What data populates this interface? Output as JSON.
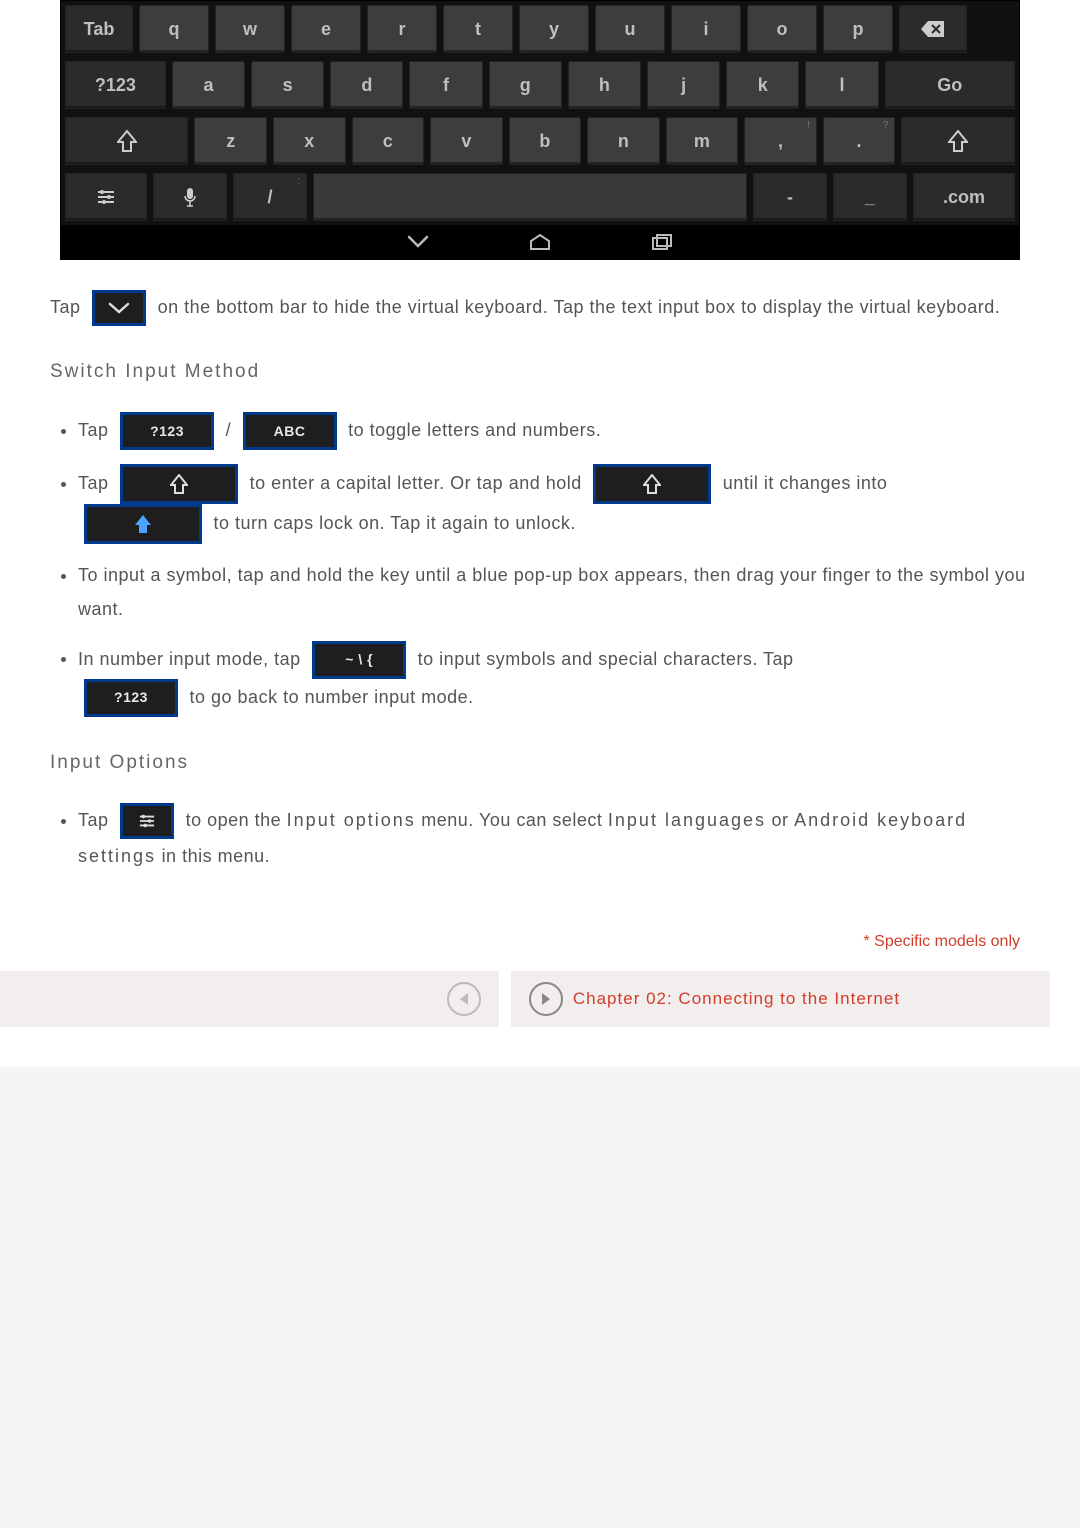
{
  "keyboard": {
    "row1": {
      "tab": "Tab",
      "keys": [
        "q",
        "w",
        "e",
        "r",
        "t",
        "y",
        "u",
        "i",
        "o",
        "p"
      ],
      "backspace_icon": "⌫"
    },
    "row2": {
      "mode": "?123",
      "keys": [
        "a",
        "s",
        "d",
        "f",
        "g",
        "h",
        "j",
        "k",
        "l"
      ],
      "go": "Go"
    },
    "row3": {
      "shift_icon": "⇧",
      "keys": [
        "z",
        "x",
        "c",
        "v",
        "b",
        "n",
        "m"
      ],
      "comma": ",",
      "period": ".",
      "comma_hint": "!",
      "period_hint": "?",
      "shiftR_icon": "⇧"
    },
    "row4": {
      "options_icon": "⎈",
      "mic_icon": "🎤",
      "slash": "/",
      "slash_hint": ":",
      "dash": "-",
      "underscore": "_",
      "com": ".com"
    },
    "navbar": {
      "hide": "⌄",
      "home": "⌂",
      "recent": "❐"
    }
  },
  "body": {
    "hide_keyboard": {
      "pre": "Tap",
      "post": "on the bottom bar to hide the virtual keyboard. Tap the text input box to display the virtual keyboard."
    },
    "switch_heading": "Switch Input Method",
    "bullets": {
      "b1": {
        "pre": "Tap",
        "chip1": "?123",
        "sep": "/",
        "chip2": "ABC",
        "post": "to toggle letters and numbers."
      },
      "b2": {
        "pre": "Tap",
        "chip1": "⇧",
        "mid": "to enter a capital letter. Or tap and hold",
        "chip2": "⇧",
        "post": "until it changes into",
        "chip3": "🔒",
        "tail": "to turn caps lock on. Tap it again to unlock."
      },
      "b3": "To input a symbol, tap and hold the key until a blue pop-up box appears, then drag your finger to the symbol you want.",
      "b4": {
        "pre": "In number input mode, tap",
        "chip1": "~ \\ {",
        "mid": "to input symbols and special characters. Tap",
        "chip2": "?123",
        "post": "to go back to number input mode."
      }
    },
    "options_heading": "Input Options",
    "options_bullet": {
      "pre": "Tap",
      "mid": "to open the",
      "bold1": "Input options",
      "mid2": "menu. You can select",
      "bold2": "Input languages",
      "mid3": "or",
      "bold3": "Android keyboard settings",
      "tail": "in this menu."
    },
    "footnote": "* Specific models only",
    "next_chapter": "Chapter 02: Connecting to the Internet"
  }
}
